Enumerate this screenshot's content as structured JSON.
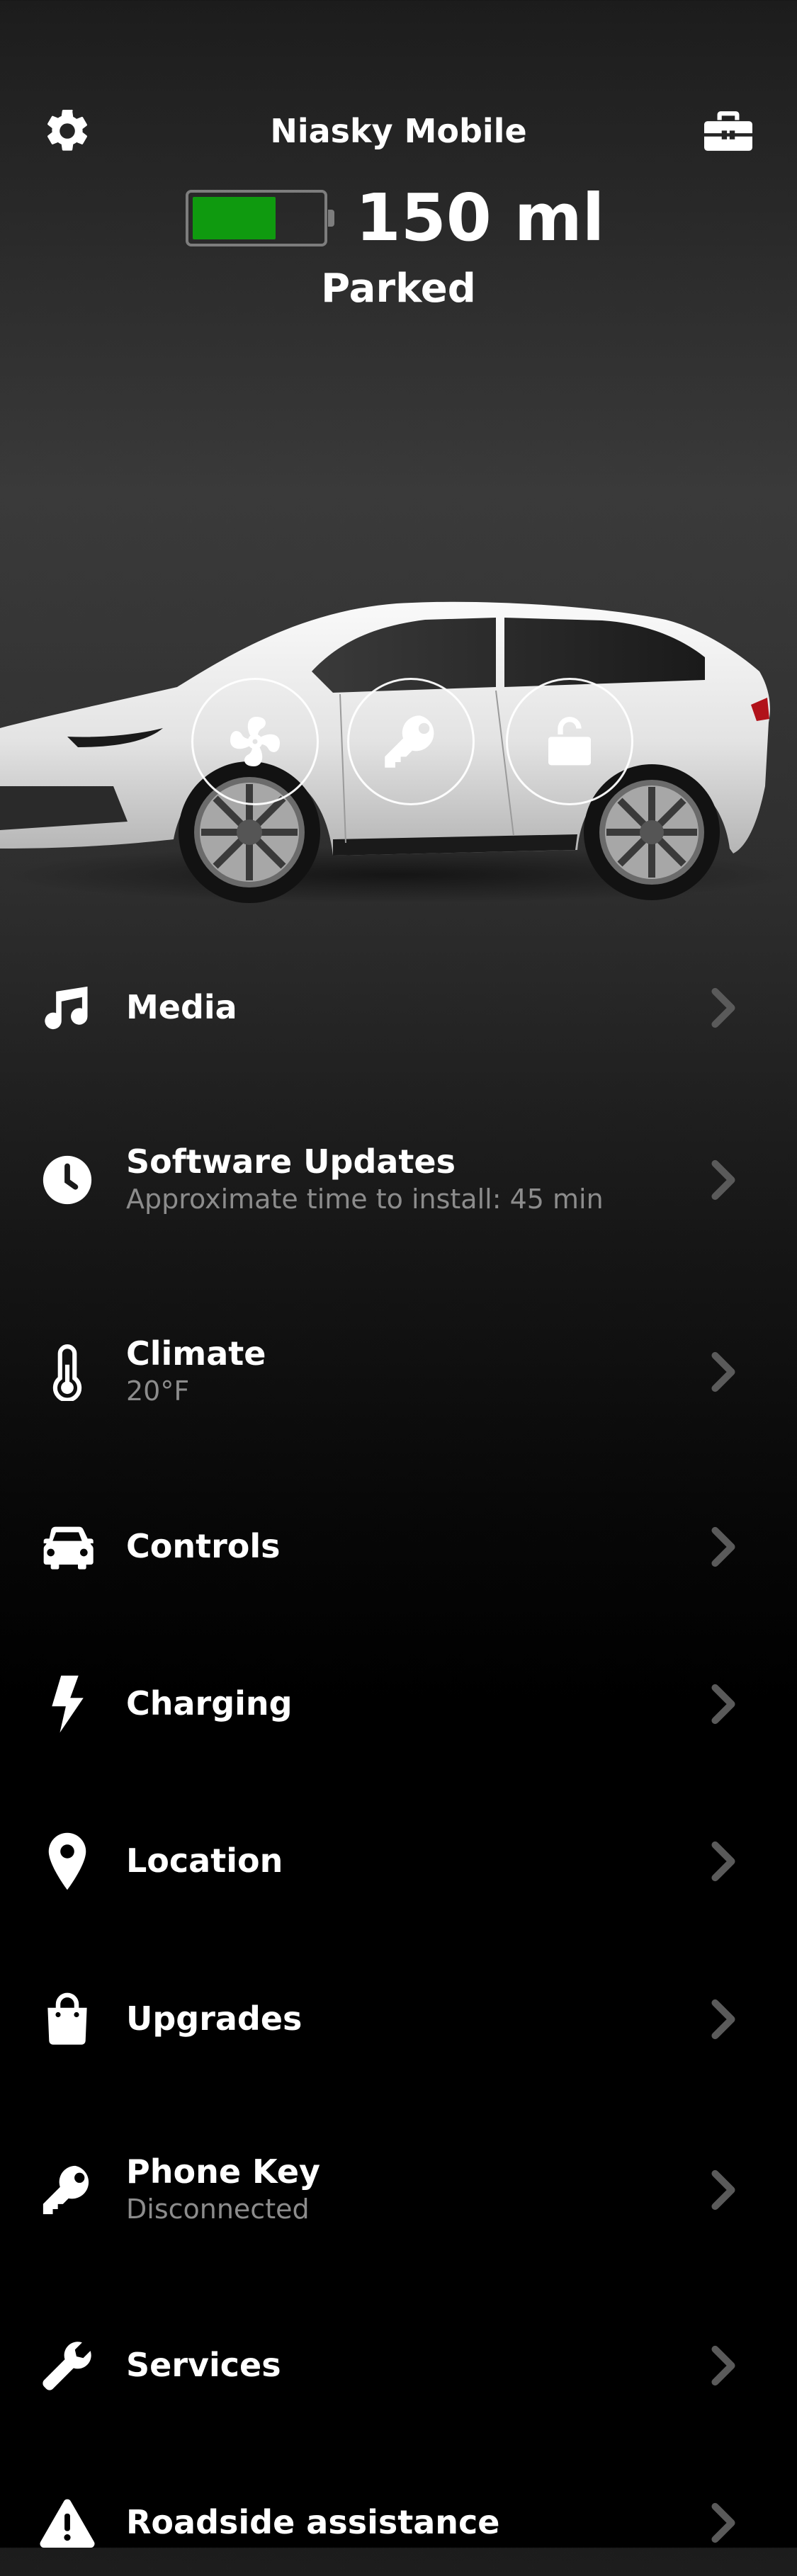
{
  "header": {
    "car_name": "Niasky Mobile",
    "range": "150 ml",
    "status": "Parked",
    "battery_level": 0.65,
    "settings_icon": "gear-icon",
    "toolbox_icon": "toolbox-icon"
  },
  "colors": {
    "battery_fill": "#0f9a0f",
    "subtitle": "#8c8c8c",
    "chevron": "#5a5a5a"
  },
  "quick_actions": [
    {
      "icon": "fan-icon"
    },
    {
      "icon": "key-icon"
    },
    {
      "icon": "unlock-icon"
    }
  ],
  "menu": {
    "items": [
      {
        "label": "Media",
        "icon": "music-note-icon"
      },
      {
        "label": "Software Updates",
        "sub": "Approximate time to install: 45 min",
        "icon": "clock-icon"
      },
      {
        "label": "Climate",
        "sub": "20°F",
        "icon": "thermometer-icon"
      },
      {
        "label": "Controls",
        "icon": "car-icon"
      },
      {
        "label": "Charging",
        "icon": "lightning-icon"
      },
      {
        "label": "Location",
        "icon": "map-pin-icon"
      },
      {
        "label": "Upgrades",
        "icon": "shopping-bag-icon"
      },
      {
        "label": "Phone Key",
        "sub": "Disconnected",
        "icon": "key-icon"
      },
      {
        "label": "Services",
        "icon": "wrench-icon"
      },
      {
        "label": "Roadside assistance",
        "icon": "warning-icon"
      }
    ]
  }
}
